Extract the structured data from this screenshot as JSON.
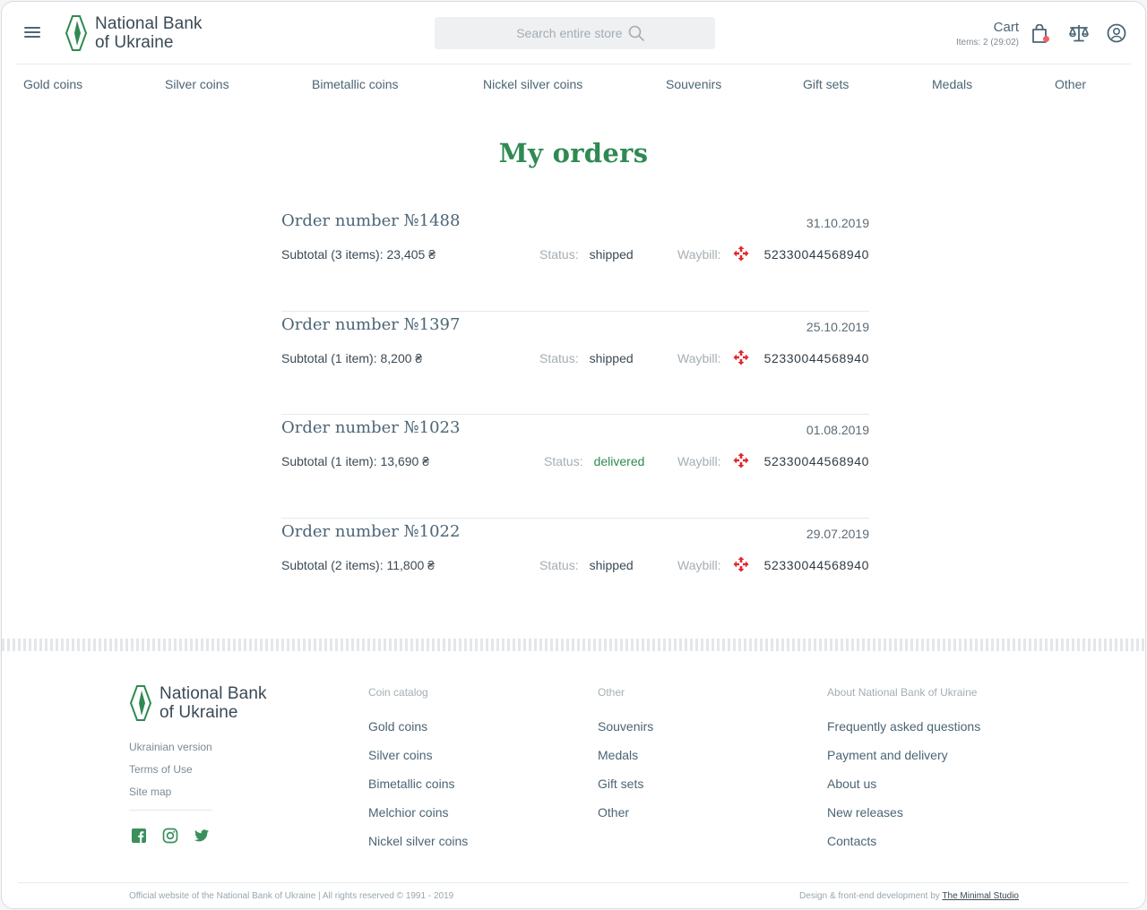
{
  "header": {
    "logo_line1": "National Bank",
    "logo_line2": "of Ukraine",
    "search_placeholder": "Search entire store",
    "cart_title": "Cart",
    "cart_items": "Items: 2 (29:02)"
  },
  "nav": {
    "items": [
      "Gold coins",
      "Silver coins",
      "Bimetallic coins",
      "Nickel silver coins",
      "Souvenirs",
      "Gift sets",
      "Medals",
      "Other"
    ]
  },
  "page_title": "My orders",
  "orders": [
    {
      "title": "Order number №1488",
      "date": "31.10.2019",
      "subtotal": "Subtotal (3 items): 23,405 ₴",
      "status_label": "Status:",
      "status": "shipped",
      "waybill_label": "Waybill:",
      "waybill": "52330044568940"
    },
    {
      "title": "Order number №1397",
      "date": "25.10.2019",
      "subtotal": "Subtotal (1 item): 8,200 ₴",
      "status_label": "Status:",
      "status": "shipped",
      "waybill_label": "Waybill:",
      "waybill": "52330044568940"
    },
    {
      "title": "Order number №1023",
      "date": "01.08.2019",
      "subtotal": "Subtotal (1 item): 13,690 ₴",
      "status_label": "Status:",
      "status": "delivered",
      "waybill_label": "Waybill:",
      "waybill": "52330044568940"
    },
    {
      "title": "Order number №1022",
      "date": "29.07.2019",
      "subtotal": "Subtotal (2 items): 11,800 ₴",
      "status_label": "Status:",
      "status": "shipped",
      "waybill_label": "Waybill:",
      "waybill": "52330044568940"
    }
  ],
  "footer": {
    "logo_line1": "National Bank",
    "logo_line2": "of Ukraine",
    "small_links": [
      "Ukrainian version",
      "Terms of Use",
      "Site map"
    ],
    "col1": {
      "heading": "Coin catalog",
      "links": [
        "Gold coins",
        "Silver coins",
        "Bimetallic coins",
        "Melchior coins",
        "Nickel silver coins"
      ]
    },
    "col2": {
      "heading": "Other",
      "links": [
        "Souvenirs",
        "Medals",
        "Gift sets",
        "Other"
      ]
    },
    "col3": {
      "heading": "About National Bank of Ukraine",
      "links": [
        "Frequently asked questions",
        "Payment and delivery",
        "About us",
        "New releases",
        "Contacts"
      ]
    },
    "copyright": "Official website of the National Bank of Ukraine | All rights reserved © 1991 - 2019",
    "credits_prefix": "Design & front-end development by ",
    "credits_link": "The Minimal Studio"
  },
  "colors": {
    "accent_green": "#2f8a52",
    "text_slate": "#4b6575",
    "cart_dot": "#f0616a",
    "nova_poshta_red": "#e3262d",
    "social_green": "#3a8f5c"
  }
}
